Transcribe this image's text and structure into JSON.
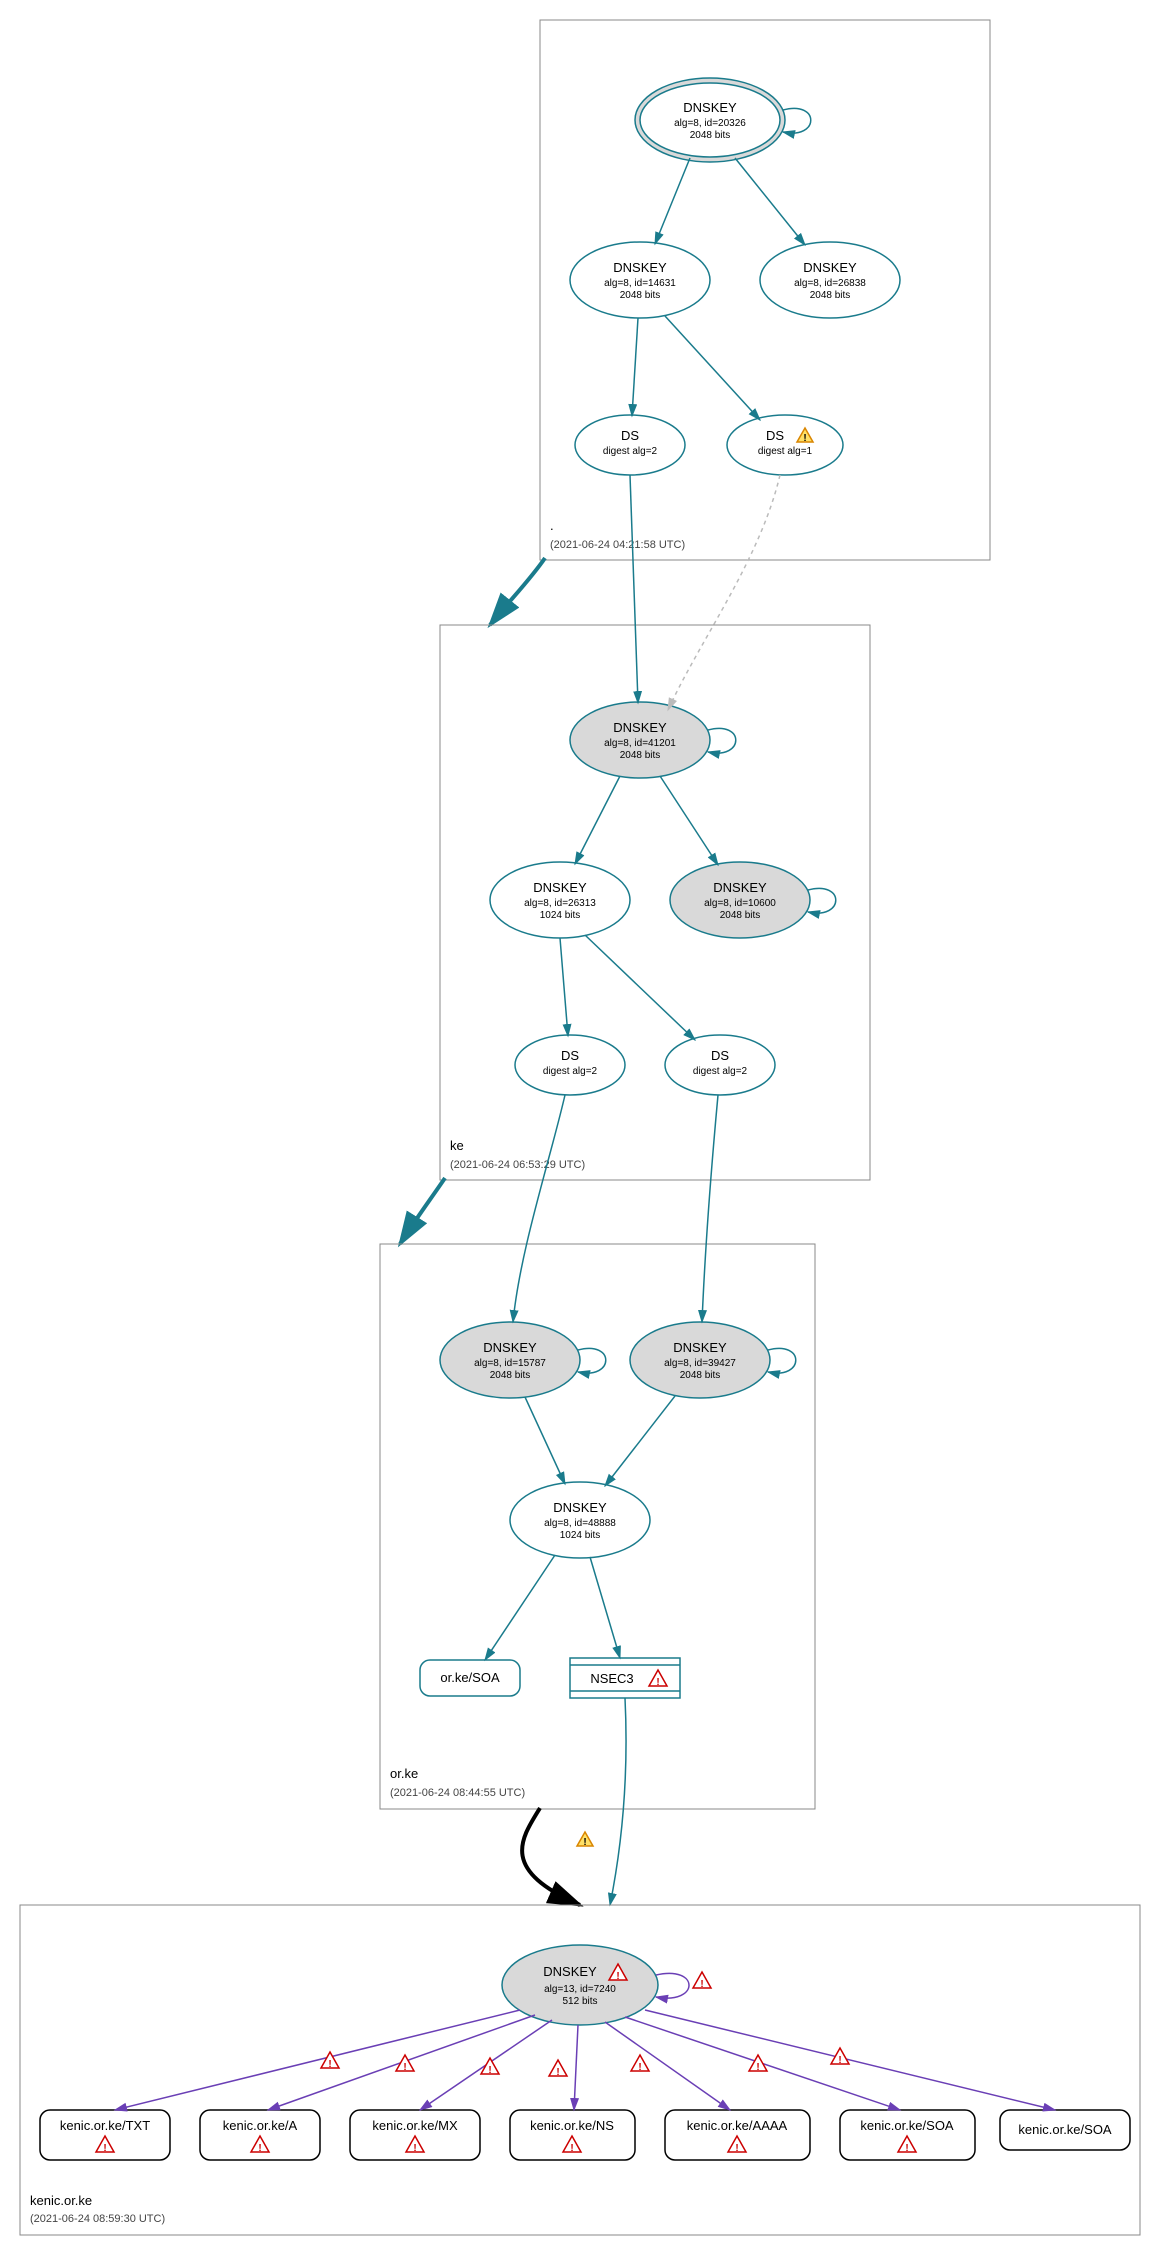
{
  "zones": {
    "root": {
      "label": ".",
      "timestamp": "(2021-06-24 04:21:58 UTC)"
    },
    "ke": {
      "label": "ke",
      "timestamp": "(2021-06-24 06:53:29 UTC)"
    },
    "orke": {
      "label": "or.ke",
      "timestamp": "(2021-06-24 08:44:55 UTC)"
    },
    "kenic": {
      "label": "kenic.or.ke",
      "timestamp": "(2021-06-24 08:59:30 UTC)"
    }
  },
  "nodes": {
    "root_ksk": {
      "title": "DNSKEY",
      "line2": "alg=8, id=20326",
      "line3": "2048 bits"
    },
    "root_zsk1": {
      "title": "DNSKEY",
      "line2": "alg=8, id=14631",
      "line3": "2048 bits"
    },
    "root_zsk2": {
      "title": "DNSKEY",
      "line2": "alg=8, id=26838",
      "line3": "2048 bits"
    },
    "root_ds1": {
      "title": "DS",
      "line2": "digest alg=2"
    },
    "root_ds2": {
      "title": "DS",
      "line2": "digest alg=1"
    },
    "ke_ksk": {
      "title": "DNSKEY",
      "line2": "alg=8, id=41201",
      "line3": "2048 bits"
    },
    "ke_zsk1": {
      "title": "DNSKEY",
      "line2": "alg=8, id=26313",
      "line3": "1024 bits"
    },
    "ke_zsk2": {
      "title": "DNSKEY",
      "line2": "alg=8, id=10600",
      "line3": "2048 bits"
    },
    "ke_ds1": {
      "title": "DS",
      "line2": "digest alg=2"
    },
    "ke_ds2": {
      "title": "DS",
      "line2": "digest alg=2"
    },
    "orke_ksk1": {
      "title": "DNSKEY",
      "line2": "alg=8, id=15787",
      "line3": "2048 bits"
    },
    "orke_ksk2": {
      "title": "DNSKEY",
      "line2": "alg=8, id=39427",
      "line3": "2048 bits"
    },
    "orke_zsk": {
      "title": "DNSKEY",
      "line2": "alg=8, id=48888",
      "line3": "1024 bits"
    },
    "orke_soa": {
      "title": "or.ke/SOA"
    },
    "orke_nsec3": {
      "title": "NSEC3"
    },
    "kenic_key": {
      "title": "DNSKEY",
      "line2": "alg=13, id=7240",
      "line3": "512 bits"
    },
    "kenic_txt": {
      "title": "kenic.or.ke/TXT"
    },
    "kenic_a": {
      "title": "kenic.or.ke/A"
    },
    "kenic_mx": {
      "title": "kenic.or.ke/MX"
    },
    "kenic_ns": {
      "title": "kenic.or.ke/NS"
    },
    "kenic_aaaa": {
      "title": "kenic.or.ke/AAAA"
    },
    "kenic_soa1": {
      "title": "kenic.or.ke/SOA"
    },
    "kenic_soa2": {
      "title": "kenic.or.ke/SOA"
    }
  }
}
